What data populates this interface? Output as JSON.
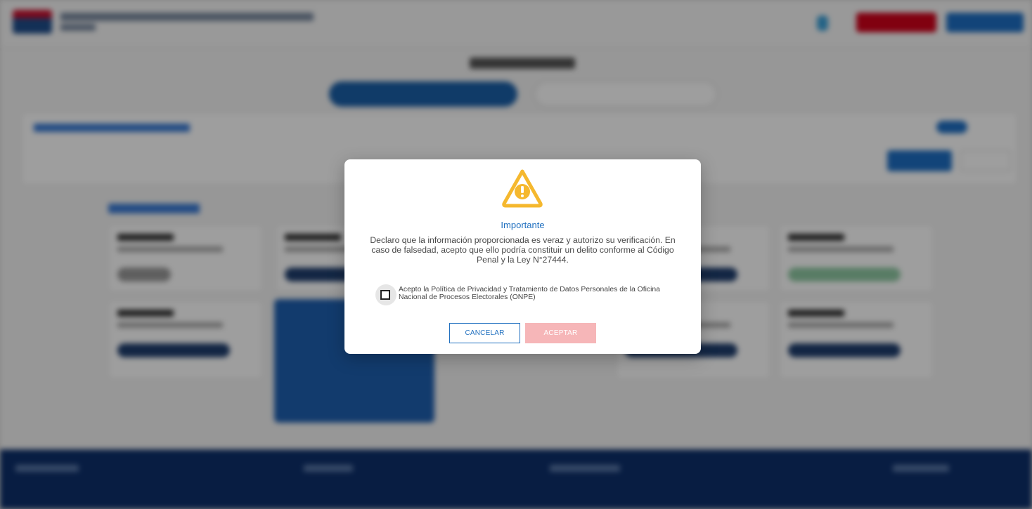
{
  "modal": {
    "title": "Importante",
    "message": "Declaro que la información proporcionada es veraz y autorizo su verificación. En caso de falsedad, acepto que ello podría constituir un delito conforme al Código Penal y la Ley N°27444.",
    "consent_label": "Acepto la Política de Privacidad y Tratamiento de Datos Personales de la Oficina Nacional de Procesos Electorales (ONPE)",
    "consent_checked": false,
    "cancel_label": "CANCELAR",
    "accept_label": "ACEPTAR",
    "icon": "warning-icon"
  },
  "colors": {
    "accent": "#1f6fbf",
    "warning": "#f5b82e",
    "accept_disabled": "#f6b6b8",
    "footer": "#0d2f6b"
  }
}
